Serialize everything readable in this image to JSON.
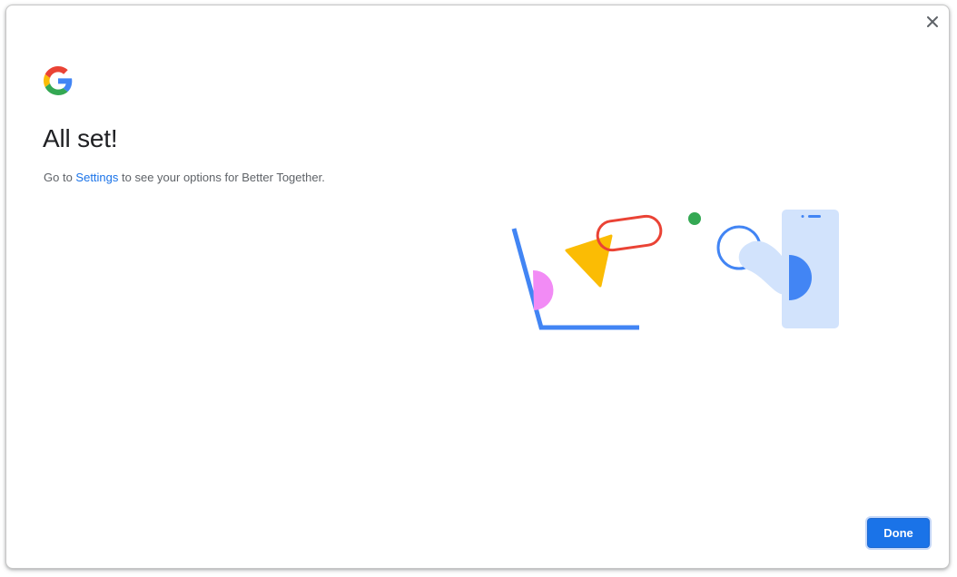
{
  "dialog": {
    "title": "All set!",
    "subtitle": {
      "prefix": "Go to ",
      "link_text": "Settings",
      "suffix": " to see your options for Better Together."
    },
    "done_label": "Done"
  },
  "icons": {
    "close": "close-icon",
    "logo": "google-logo-icon"
  },
  "colors": {
    "accent": "#1a73e8",
    "title_text": "#202124",
    "body_text": "#5f6368",
    "google_blue": "#4285f4",
    "google_red": "#ea4335",
    "google_yellow": "#fbbc04",
    "google_green": "#34a853",
    "pink": "#f28bf5",
    "light_blue": "#d2e3fc"
  }
}
